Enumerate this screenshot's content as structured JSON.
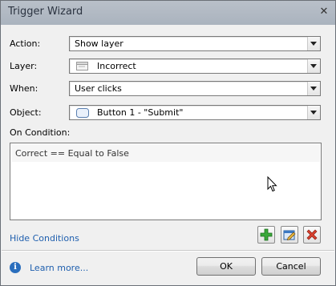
{
  "window": {
    "title": "Trigger Wizard",
    "close_glyph": "✕"
  },
  "fields": [
    {
      "label": "Action:",
      "value": "Show layer",
      "icon": ""
    },
    {
      "label": "Layer:",
      "value": "Incorrect",
      "icon": "layer-icon"
    },
    {
      "label": "When:",
      "value": "User clicks",
      "icon": ""
    },
    {
      "label": "Object:",
      "value": "Button 1 - \"Submit\"",
      "icon": "button-object-icon"
    }
  ],
  "conditions": {
    "label": "On Condition:",
    "items": [
      "Correct == Equal to False"
    ]
  },
  "hide_conditions_link": "Hide Conditions",
  "condition_buttons": [
    {
      "name": "add-condition-button",
      "icon": "plus-icon",
      "color": "#2e9b2e"
    },
    {
      "name": "edit-condition-button",
      "icon": "edit-icon",
      "color": "#2a6ebd"
    },
    {
      "name": "delete-condition-button",
      "icon": "delete-icon",
      "color": "#d43a2a"
    }
  ],
  "footer": {
    "info_glyph": "i",
    "learn_more": "Learn more...",
    "ok": "OK",
    "cancel": "Cancel"
  }
}
